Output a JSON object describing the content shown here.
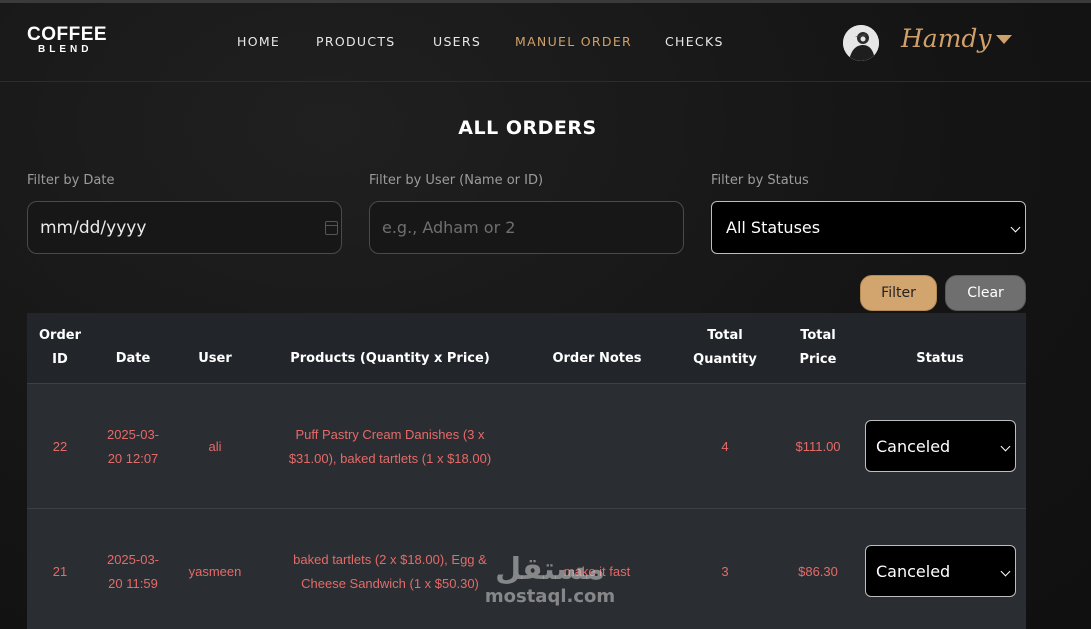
{
  "brand": {
    "main": "COFFEE",
    "sub": "BLEND"
  },
  "nav": [
    {
      "label": "HOME",
      "active": false
    },
    {
      "label": "PRODUCTS",
      "active": false
    },
    {
      "label": "USERS",
      "active": false
    },
    {
      "label": "MANUEL ORDER",
      "active": true
    },
    {
      "label": "CHECKS",
      "active": false
    }
  ],
  "user": {
    "name": "Hamdy",
    "avatar_icon": "user-avatar-icon"
  },
  "page_title": "ALL ORDERS",
  "filters": {
    "date": {
      "label": "Filter by Date",
      "value": "mm/dd/yyyy"
    },
    "user": {
      "label": "Filter by User (Name or ID)",
      "placeholder": "e.g., Adham or 2"
    },
    "status": {
      "label": "Filter by Status",
      "selected": "All Statuses"
    },
    "filter_button": "Filter",
    "clear_button": "Clear"
  },
  "table": {
    "headers": {
      "order_id": [
        "Order",
        "ID"
      ],
      "date": "Date",
      "user": "User",
      "products": "Products (Quantity x Price)",
      "notes": "Order Notes",
      "total_quantity": [
        "Total",
        "Quantity"
      ],
      "total_price": [
        "Total",
        "Price"
      ],
      "status": "Status"
    },
    "rows": [
      {
        "order_id": "22",
        "date": [
          "2025-03-",
          "20 12:07"
        ],
        "user": "ali",
        "products": [
          "Puff Pastry Cream Danishes (3 x",
          "$31.00), baked tartlets (1 x $18.00)"
        ],
        "notes": "",
        "total_quantity": "4",
        "total_price": "$111.00",
        "status": "Canceled"
      },
      {
        "order_id": "21",
        "date": [
          "2025-03-",
          "20 11:59"
        ],
        "user": "yasmeen",
        "products": [
          "baked tartlets (2 x $18.00), Egg &",
          "Cheese Sandwich (1 x $50.30)"
        ],
        "notes": "make it fast",
        "total_quantity": "3",
        "total_price": "$86.30",
        "status": "Canceled"
      }
    ]
  },
  "watermark": {
    "arabic": "مستقل",
    "latin": "mostaql.com"
  },
  "colors": {
    "accent": "#d0a06a",
    "row_text": "#e56b68",
    "background": "#161616"
  }
}
